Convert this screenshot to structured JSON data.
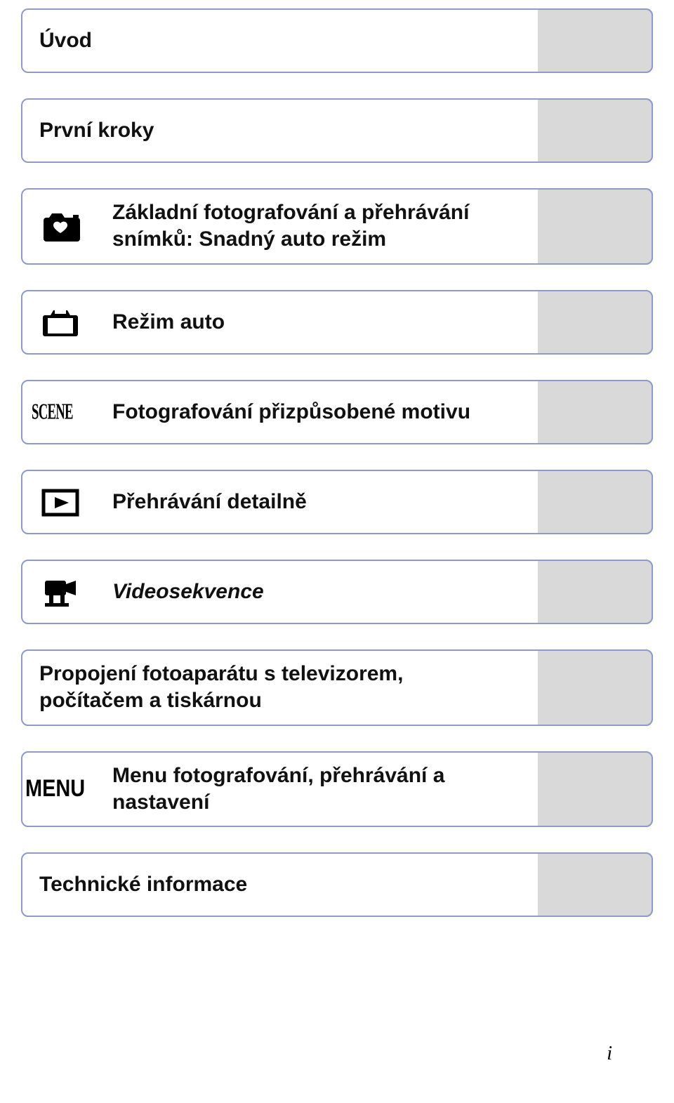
{
  "items": [
    {
      "label": "Úvod",
      "icon": null
    },
    {
      "label": "První kroky",
      "icon": null
    },
    {
      "label": "Základní fotografování a přehrávání snímků: Snadný auto režim",
      "icon": "camera-heart"
    },
    {
      "label": "Režim auto",
      "icon": "camera"
    },
    {
      "label": "Fotografování přizpůsobené motivu",
      "icon": "scene"
    },
    {
      "label": "Přehrávání detailně",
      "icon": "play-frame"
    },
    {
      "label": "Videosekvence",
      "icon": "camcorder"
    },
    {
      "label": "Propojení fotoaparátu s televizorem, počítačem a tiskárnou",
      "icon": null
    },
    {
      "label": "Menu fotografování, přehrávání a nastavení",
      "icon": "menu"
    },
    {
      "label": "Technické informace",
      "icon": null
    }
  ],
  "page_number": "i"
}
